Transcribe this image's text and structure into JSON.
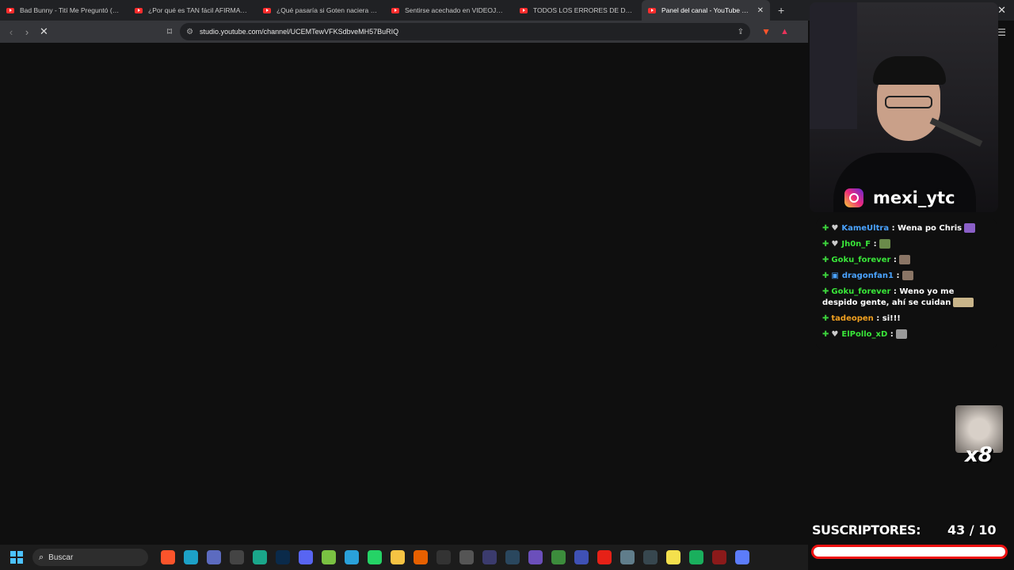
{
  "tabs": [
    {
      "title": "Bad Bunny - Tití Me Preguntó (Video"
    },
    {
      "title": "¿Por qué es TAN fácil AFIRMAR que l"
    },
    {
      "title": "¿Qué pasaría si Goten naciera primer"
    },
    {
      "title": "Sentirse acechado en VIDEOJUEGOS"
    },
    {
      "title": "TODOS LOS ERRORES DE DRAGON B"
    },
    {
      "title": "Panel del canal - YouTube Studio",
      "active": true
    }
  ],
  "address": {
    "url": "studio.youtube.com/channel/UCEMTewVFKSdbveMH57BuRIQ"
  },
  "overlay": {
    "instagram": "mexi_ytc",
    "chat": [
      {
        "user": "KameUltra",
        "color": "#4aa3ff",
        "text": ": Wena po Chris"
      },
      {
        "user": "Jh0n_F",
        "color": "#39e639",
        "text": ":"
      },
      {
        "user": "Goku_forever",
        "color": "#39e639",
        "text": ":"
      },
      {
        "user": "dragonfan1",
        "color": "#4aa3ff",
        "text": ":"
      },
      {
        "user": "Goku_forever",
        "color": "#39e639",
        "text": ": Weno yo me despido gente, ahí se cuidan"
      },
      {
        "user": "tadeopen",
        "color": "#f0a020",
        "text": ": si!!!"
      },
      {
        "user": "ElPollo_xD",
        "color": "#39e639",
        "text": ":"
      }
    ],
    "multiplier": "x8",
    "subs_label": "SUSCRIPTORES:",
    "subs_count": "43  / 10",
    "subs_progress": 1.0
  },
  "taskbar": {
    "search_placeholder": "Buscar",
    "apps": [
      {
        "icon": "brave-icon",
        "color": "#fb542b"
      },
      {
        "icon": "edge-icon",
        "color": "#1da1c7"
      },
      {
        "icon": "vivaldi-icon",
        "color": "#5c6bc0"
      },
      {
        "icon": "capcut-icon",
        "color": "#444"
      },
      {
        "icon": "app-green-icon",
        "color": "#1aa68a"
      },
      {
        "icon": "photoshop-icon",
        "color": "#0a2a4a"
      },
      {
        "icon": "discord-icon",
        "color": "#5865f2"
      },
      {
        "icon": "app-lime-icon",
        "color": "#7ac142"
      },
      {
        "icon": "telegram-icon",
        "color": "#2aa1da"
      },
      {
        "icon": "whatsapp-icon",
        "color": "#25d366"
      },
      {
        "icon": "folder-icon",
        "color": "#f6c343"
      },
      {
        "icon": "firefox-icon",
        "color": "#e66000"
      },
      {
        "icon": "epic-icon",
        "color": "#333"
      },
      {
        "icon": "app-gray-icon",
        "color": "#555"
      },
      {
        "icon": "obs-icon",
        "color": "#3b3b6d"
      },
      {
        "icon": "steam-icon",
        "color": "#2a475e"
      },
      {
        "icon": "app-purple-icon",
        "color": "#6b4fbb"
      },
      {
        "icon": "app-green2-icon",
        "color": "#3c8c3c"
      },
      {
        "icon": "app-blue-icon",
        "color": "#3f51b5"
      },
      {
        "icon": "youtube-music-icon",
        "color": "#e62117"
      },
      {
        "icon": "app-image-icon",
        "color": "#607d8b"
      },
      {
        "icon": "app-dark-icon",
        "color": "#37474f"
      },
      {
        "icon": "sticky-notes-icon",
        "color": "#f4e04d"
      },
      {
        "icon": "app-teal-icon",
        "color": "#1aaf5d"
      },
      {
        "icon": "app-red-icon",
        "color": "#8b1a1a"
      },
      {
        "icon": "app-diamond-icon",
        "color": "#5c7cfa"
      }
    ]
  }
}
